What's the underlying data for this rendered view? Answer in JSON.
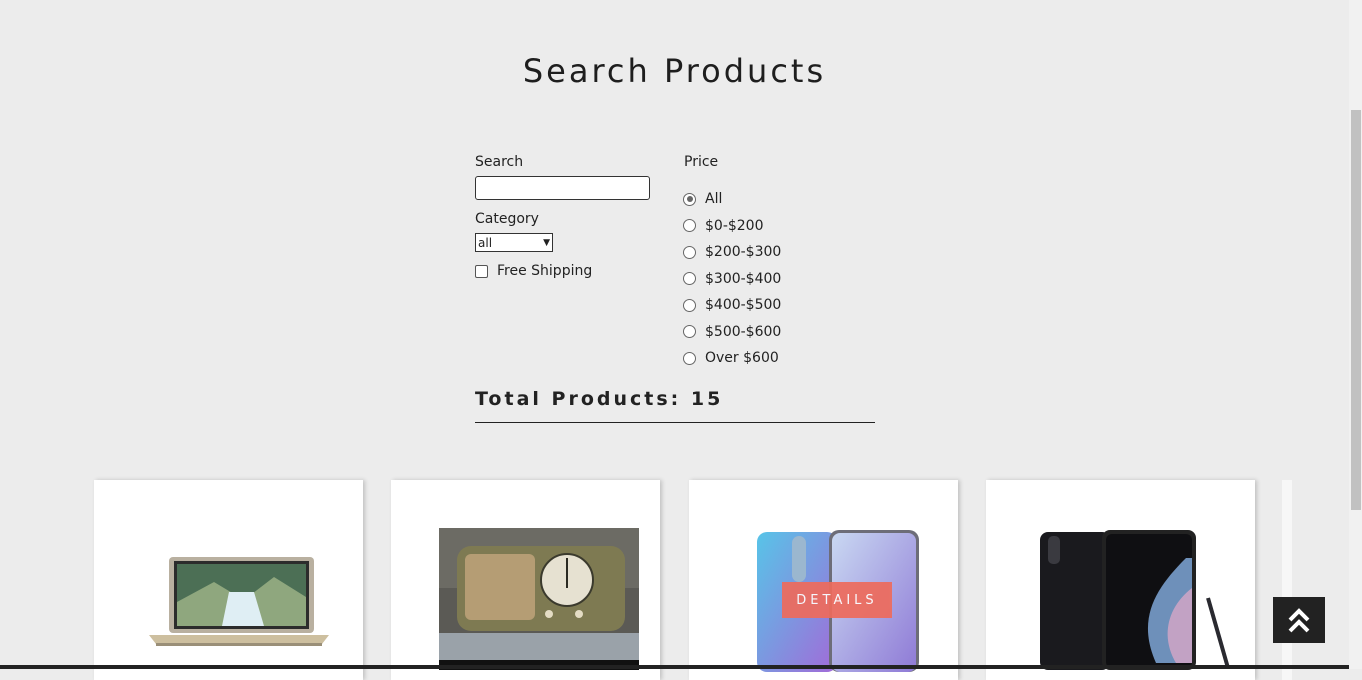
{
  "page": {
    "title": "Search Products"
  },
  "filters": {
    "search_label": "Search",
    "search_value": "",
    "category_label": "Category",
    "category_selected": "all",
    "free_shipping_label": "Free Shipping",
    "price_label": "Price",
    "price_options": [
      "All",
      "$0-$200",
      "$200-$300",
      "$300-$400",
      "$400-$500",
      "$500-$600",
      "Over $600"
    ],
    "price_selected": "All"
  },
  "summary": {
    "total_text": "Total Products: 15"
  },
  "products": [
    {
      "image": "laptop"
    },
    {
      "image": "vintage-radio"
    },
    {
      "image": "phone",
      "overlay_button": "DETAILS"
    },
    {
      "image": "phone-with-stylus"
    }
  ],
  "icons": {
    "scroll_top": "double-chevron-up-icon"
  },
  "colors": {
    "details_button": "#ee6b5c",
    "background": "#ececec"
  }
}
